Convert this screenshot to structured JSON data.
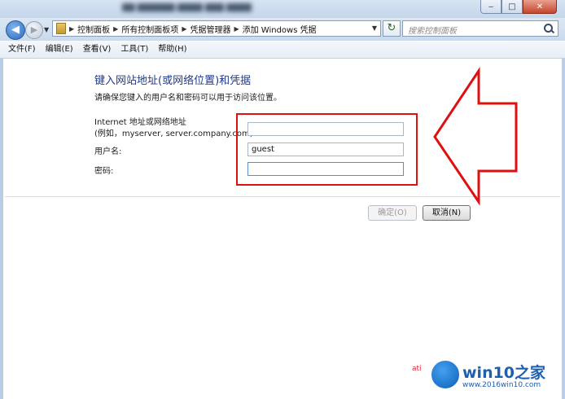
{
  "titlebar": {
    "blurred_title": "██ ██████ ████ ███ ████",
    "minimize": "‒",
    "maximize": "□",
    "close": "✕"
  },
  "address": {
    "breadcrumbs": [
      "控制面板",
      "所有控制面板项",
      "凭据管理器",
      "添加 Windows 凭据"
    ],
    "search_placeholder": "搜索控制面板"
  },
  "menu": [
    "文件(F)",
    "编辑(E)",
    "查看(V)",
    "工具(T)",
    "帮助(H)"
  ],
  "form": {
    "heading": "键入网站地址(或网络位置)和凭据",
    "intro": "请确保您键入的用户名和密码可以用于访问该位置。",
    "address_label_line1": "Internet 地址或网络地址",
    "address_label_line2": "(例如，myserver, server.company.com):",
    "address_value": "",
    "username_label": "用户名:",
    "username_value": "guest",
    "password_label": "密码:",
    "password_value": ""
  },
  "buttons": {
    "ok": "确定(O)",
    "cancel": "取消(N)"
  },
  "watermark": {
    "name": "win10之家",
    "url": "www.2016win10.com",
    "small": "ati"
  },
  "colors": {
    "heading": "#1e3a8a",
    "highlight": "#e01010",
    "watermark": "#1e5fb0"
  }
}
